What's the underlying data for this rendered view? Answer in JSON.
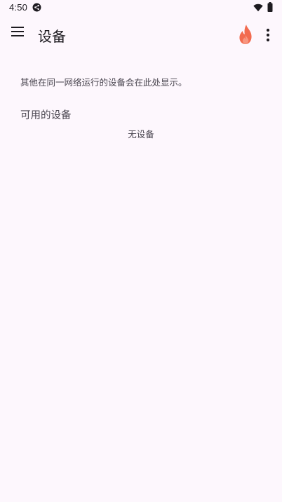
{
  "status_bar": {
    "time": "4:50"
  },
  "app_bar": {
    "title": "设备"
  },
  "main": {
    "info_text": "其他在同一网络运行的设备会在此处显示。",
    "section_title": "可用的设备",
    "empty_label": "无设备"
  },
  "colors": {
    "background": "#fdf7fd",
    "flame": "#f26b4f"
  }
}
